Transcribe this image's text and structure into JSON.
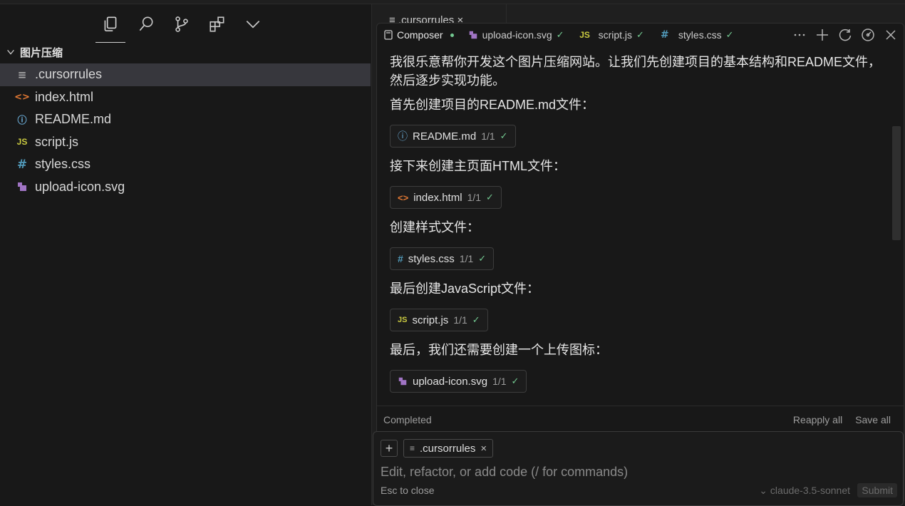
{
  "sidebar": {
    "folder_name": "图片压缩",
    "files": [
      {
        "name": ".cursorrules",
        "icon": "lines-file-icon",
        "glyph": "≡"
      },
      {
        "name": "index.html",
        "icon": "html-file-icon",
        "glyph": "<>"
      },
      {
        "name": "README.md",
        "icon": "info-file-icon",
        "glyph": "ⓘ"
      },
      {
        "name": "script.js",
        "icon": "js-file-icon",
        "glyph": "JS"
      },
      {
        "name": "styles.css",
        "icon": "css-file-icon",
        "glyph": "#"
      },
      {
        "name": "upload-icon.svg",
        "icon": "svg-file-icon",
        "glyph": "▪"
      }
    ]
  },
  "editor": {
    "tab_label": "≡  .cursorrules  ×"
  },
  "composer": {
    "tabs": [
      {
        "label": "Composer"
      },
      {
        "label": "upload-icon.svg",
        "check": "✓"
      },
      {
        "label": "script.js",
        "check": "✓"
      },
      {
        "label": "styles.css",
        "check": "✓"
      }
    ],
    "messages": [
      "我很乐意帮你开发这个图片压缩网站。让我们先创建项目的基本结构和README文件，然后逐步实现功能。",
      "首先创建项目的README.md文件：",
      "接下来创建主页面HTML文件：",
      "创建样式文件：",
      "最后创建JavaScript文件：",
      "最后，我们还需要创建一个上传图标："
    ],
    "chips": [
      {
        "name": "README.md",
        "count": "1/1",
        "check": "✓"
      },
      {
        "name": "index.html",
        "count": "1/1",
        "check": "✓"
      },
      {
        "name": "styles.css",
        "count": "1/1",
        "check": "✓"
      },
      {
        "name": "script.js",
        "count": "1/1",
        "check": "✓"
      },
      {
        "name": "upload-icon.svg",
        "count": "1/1",
        "check": "✓"
      }
    ],
    "status": "Completed",
    "reapply_label": "Reapply all",
    "save_label": "Save all"
  },
  "input": {
    "context_file": ".cursorrules",
    "context_glyph": "≡",
    "placeholder": "Edit, refactor, or add code (/ for commands)",
    "esc_hint": "Esc to close",
    "model": "claude-3.5-sonnet",
    "submit_label": "Submit"
  }
}
